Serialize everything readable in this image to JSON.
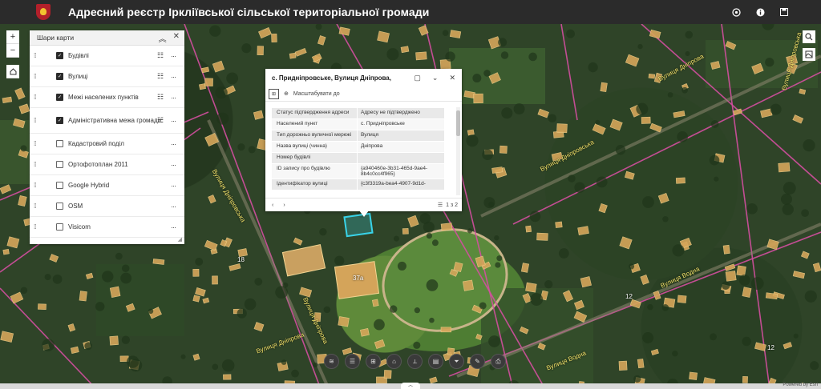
{
  "header": {
    "title": "Адресний реєстр Ірклiївської сільської територіальної громади"
  },
  "layers_panel": {
    "title": "Шари карти",
    "items": [
      {
        "label": "Будівлі",
        "checked": true,
        "legend": true
      },
      {
        "label": "Вулиці",
        "checked": true,
        "legend": true
      },
      {
        "label": "Межі населених пунктів",
        "checked": true,
        "legend": true
      },
      {
        "label": "Адміністративна межа громади",
        "checked": true,
        "legend": true
      },
      {
        "label": "Кадастровий поділ",
        "checked": false,
        "legend": false
      },
      {
        "label": "Ортофотоплан 2011",
        "checked": false,
        "legend": false
      },
      {
        "label": "Google Hybrid",
        "checked": false,
        "legend": false
      },
      {
        "label": "OSM",
        "checked": false,
        "legend": false
      },
      {
        "label": "Visicom",
        "checked": false,
        "legend": false
      }
    ]
  },
  "popup": {
    "title": "с. Придніпровське, Вулиця Дніпрова,",
    "zoom_label": "Масштабувати до",
    "rows": [
      {
        "key": "Статус підтвердження адреси",
        "value": "Адресу не підтверджено"
      },
      {
        "key": "Населений пункт",
        "value": "с. Придніпровське"
      },
      {
        "key": "Тип дорожньо вуличної мережі",
        "value": "Вулиця"
      },
      {
        "key": "Назва вулиці (чинна)",
        "value": "Дніпрова"
      },
      {
        "key": "Номер будівлі",
        "value": ""
      },
      {
        "key": "ID запису про будівлю",
        "value": "{a940460e-3b31-465d-9ae4-8b4c0cc4f965}"
      },
      {
        "key": "Ідентифікатор вулиці",
        "value": "{c3f3319a-bea4-4907-9d1d-"
      }
    ],
    "counter": "1 з 2"
  },
  "map": {
    "street_labels": [
      {
        "text": "Вулиця Дніпрова",
        "name": "label-dniprova-top"
      },
      {
        "text": "Вулиця Дніпровська",
        "name": "label-dniprovska-right"
      },
      {
        "text": "Вулиця Дніпровська",
        "name": "label-dniprovska-mid"
      },
      {
        "text": "Вулиця Дніпровська",
        "name": "label-dniprovska-left"
      },
      {
        "text": "Вулиця Дніпрова",
        "name": "label-dniprova-bottom"
      },
      {
        "text": "Вулиця Дніпрова",
        "name": "label-dniprova-bottom2"
      },
      {
        "text": "Вулиця Водна",
        "name": "label-vodna"
      },
      {
        "text": "Вулиця Водна",
        "name": "label-vodna2"
      }
    ],
    "building_numbers": [
      "37а",
      "18",
      "12",
      "12"
    ]
  },
  "footer": {
    "powered": "Powered by Esri"
  },
  "colors": {
    "header_bg": "#2b2b2b",
    "street_line": "#d44fa0",
    "label": "#f2e36a",
    "building": "#d6a65a"
  }
}
